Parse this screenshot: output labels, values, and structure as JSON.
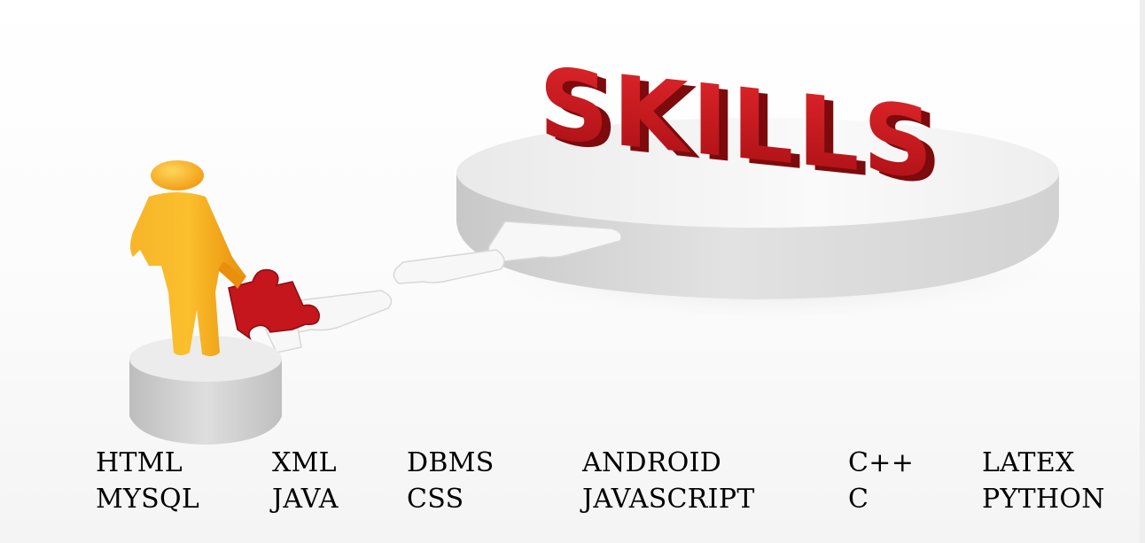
{
  "banner": {
    "word": "SKILLS"
  },
  "skills": {
    "row1": [
      "HTML",
      "XML",
      "DBMS",
      "ANDROID",
      "C++",
      "LATEX"
    ],
    "row2": [
      "MYSQL",
      "JAVA",
      "CSS",
      "JAVASCRIPT",
      "C",
      "PYTHON"
    ]
  },
  "colors": {
    "skills_text": "#c8181e",
    "figure": "#f5a418",
    "puzzle_red": "#c4161c",
    "platform": "#e6e6e6"
  },
  "icons": [
    "person-figure-icon",
    "puzzle-piece-icon",
    "platform-icon"
  ]
}
